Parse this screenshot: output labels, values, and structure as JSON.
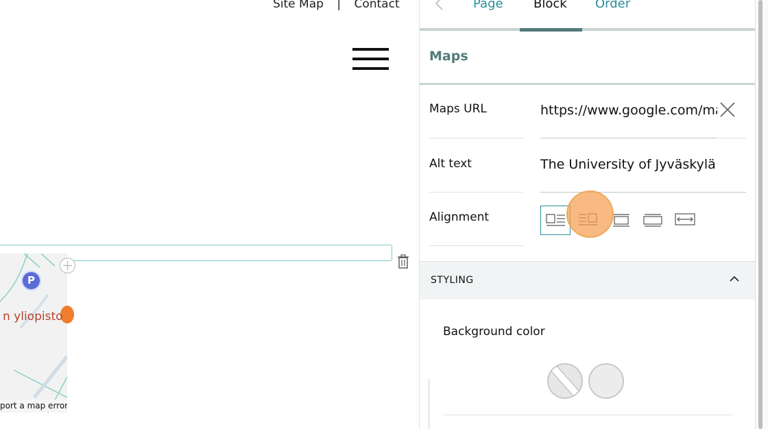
{
  "header": {
    "site_map": "Site Map",
    "separator": "|",
    "contact": "Contact"
  },
  "map": {
    "place_label": "n yliopisto",
    "parking_label": "P",
    "report_error": "port a map error"
  },
  "sidebar": {
    "tabs": {
      "page": "Page",
      "block": "Block",
      "order": "Order",
      "active": "Block"
    },
    "section_title": "Maps",
    "fields": {
      "maps_url_label": "Maps URL",
      "maps_url_value": "https://www.google.com/maps/embed?pb=",
      "alt_text_label": "Alt text",
      "alt_text_value": "The University of Jyväskylä",
      "alignment_label": "Alignment",
      "alignment_options": [
        "left",
        "wrap-left",
        "center",
        "full-center",
        "full-width"
      ],
      "alignment_selected": "left"
    },
    "styling": {
      "label": "STYLING",
      "expanded": true,
      "background_color_label": "Background color",
      "swatches": [
        "none",
        "light-grey"
      ]
    }
  },
  "colors": {
    "accent": "#2a8d99",
    "section_title": "#527b7b",
    "block_outline": "#7cc9c6",
    "click_highlight": "#f5a050"
  }
}
